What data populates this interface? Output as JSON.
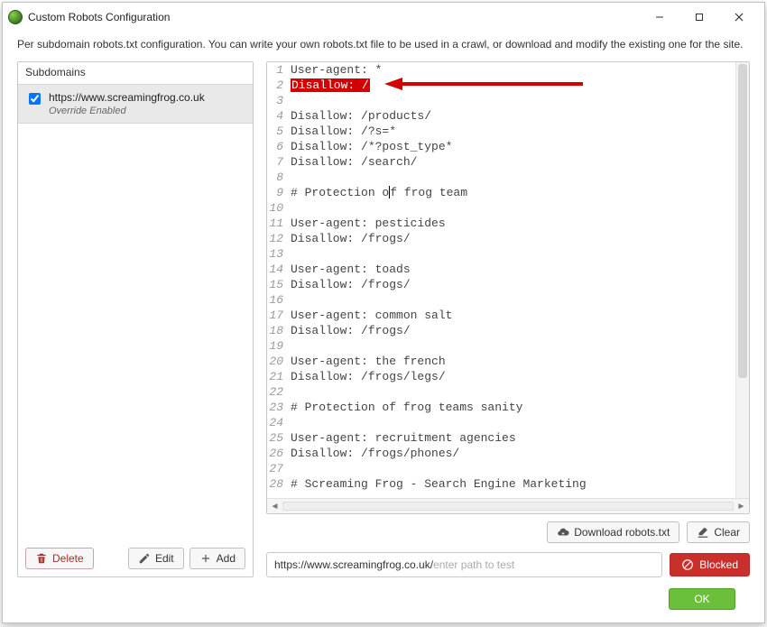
{
  "window": {
    "title": "Custom Robots Configuration"
  },
  "intro": "Per subdomain robots.txt configuration. You can write your own robots.txt file to be used in a crawl, or download and modify the existing one for the site.",
  "left": {
    "header": "Subdomains",
    "items": [
      {
        "checked": true,
        "url": "https://www.screamingfrog.co.uk",
        "override_label": "Override Enabled"
      }
    ],
    "buttons": {
      "delete": "Delete",
      "edit": "Edit",
      "add": "Add"
    }
  },
  "editor": {
    "lines": [
      "User-agent: *",
      {
        "highlight": "Disallow: /"
      },
      "",
      "Disallow: /products/",
      "Disallow: /?s=*",
      "Disallow: /*?post_type*",
      "Disallow: /search/",
      "",
      {
        "pre": "# Protection o",
        "cursor": true,
        "post": "f frog team"
      },
      "",
      "User-agent: pesticides",
      "Disallow: /frogs/",
      "",
      "User-agent: toads",
      "Disallow: /frogs/",
      "",
      "User-agent: common salt",
      "Disallow: /frogs/",
      "",
      "User-agent: the french",
      "Disallow: /frogs/legs/",
      "",
      "# Protection of frog teams sanity",
      "",
      "User-agent: recruitment agencies",
      "Disallow: /frogs/phones/",
      "",
      "# Screaming Frog - Search Engine Marketing"
    ]
  },
  "right_buttons": {
    "download": "Download robots.txt",
    "clear": "Clear"
  },
  "test": {
    "prefix": "https://www.screamingfrog.co.uk/",
    "placeholder": "enter path to test",
    "result": "Blocked"
  },
  "footer": {
    "ok": "OK"
  }
}
